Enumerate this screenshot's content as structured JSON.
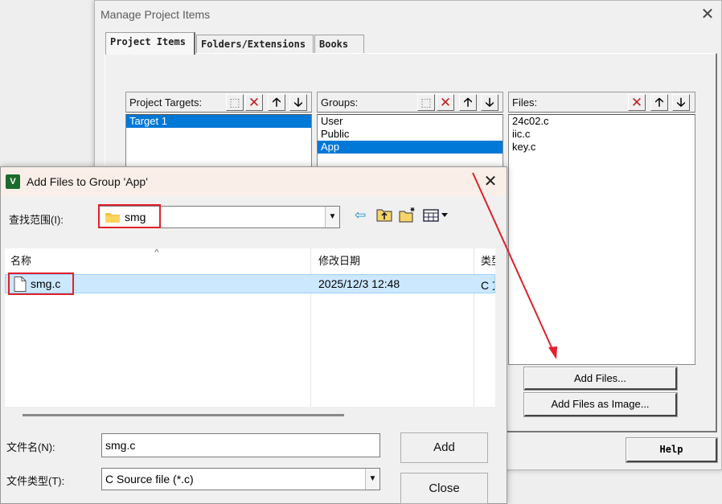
{
  "manage_window": {
    "title": "Manage Project Items",
    "tabs": [
      "Project Items",
      "Folders/Extensions",
      "Books"
    ],
    "project_targets": {
      "label": "Project Targets:",
      "items": [
        "Target 1"
      ],
      "selected": 0
    },
    "groups": {
      "label": "Groups:",
      "items": [
        "User",
        "Public",
        "App"
      ],
      "selected": 2
    },
    "files": {
      "label": "Files:",
      "items": [
        "24c02.c",
        "iic.c",
        "key.c"
      ]
    },
    "add_files_button": "Add Files...",
    "add_files_image_button": "Add Files as Image...",
    "help_button": "Help"
  },
  "add_files_dialog": {
    "title": "Add Files to Group 'App'",
    "look_in_label": "查找范围(I):",
    "look_in_value": "smg",
    "columns": [
      "名称",
      "修改日期",
      "类型"
    ],
    "files": [
      {
        "name": "smg.c",
        "modified": "2025/12/3 12:48",
        "type": "C 文件"
      }
    ],
    "filename_label": "文件名(N):",
    "filename_value": "smg.c",
    "filetype_label": "文件类型(T):",
    "filetype_value": "C Source file (*.c)",
    "add_button": "Add",
    "close_button": "Close"
  },
  "colors": {
    "selection": "#0078d7",
    "highlight_row": "#cce8ff",
    "annotation_red": "#e0202a"
  },
  "icons": [
    "new-item-icon",
    "delete-icon",
    "move-up-icon",
    "move-down-icon",
    "back-icon",
    "up-folder-icon",
    "new-folder-icon",
    "view-menu-icon",
    "folder-icon",
    "file-icon",
    "close-icon",
    "app-icon"
  ]
}
